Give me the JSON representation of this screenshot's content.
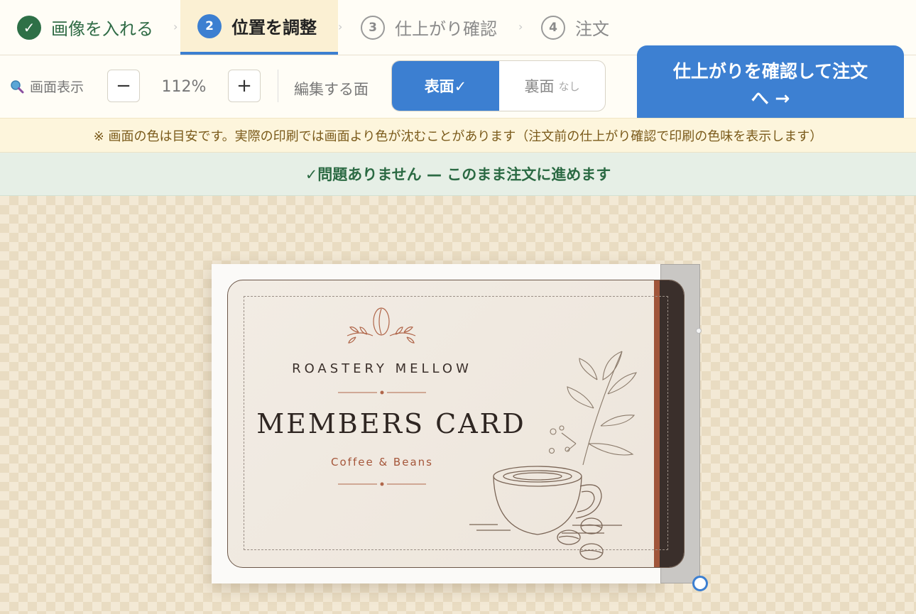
{
  "steps": {
    "step1": {
      "icon": "✓",
      "label": "画像を入れる"
    },
    "step2": {
      "num": "2",
      "label": "位置を調整"
    },
    "step3": {
      "num": "3",
      "label": "仕上がり確認"
    },
    "step4": {
      "num": "4",
      "label": "注文"
    },
    "separator": "›"
  },
  "toolbar": {
    "zoom_label": "画面表示",
    "zoom_minus": "−",
    "zoom_value": "112%",
    "zoom_plus": "+",
    "face_label": "編集する面",
    "face_front": "表面✓",
    "face_back": "裏面",
    "face_back_note": "なし",
    "order_line1": "仕上がりを確認して注文",
    "order_line2": "へ →"
  },
  "notice": "※ 画面の色は目安です。実際の印刷では画面より色が沈むことがあります（注文前の仕上がり確認で印刷の色味を表示します）",
  "status_ok": "✓問題ありません — このまま注文に進めます",
  "card": {
    "brand": "ROASTERY MELLOW",
    "title": "MEMBERS CARD",
    "subtitle": "Coffee & Beans"
  },
  "colors": {
    "accent": "#3c7fd1",
    "done_green": "#2e7047",
    "card_brown": "#a5563a"
  }
}
